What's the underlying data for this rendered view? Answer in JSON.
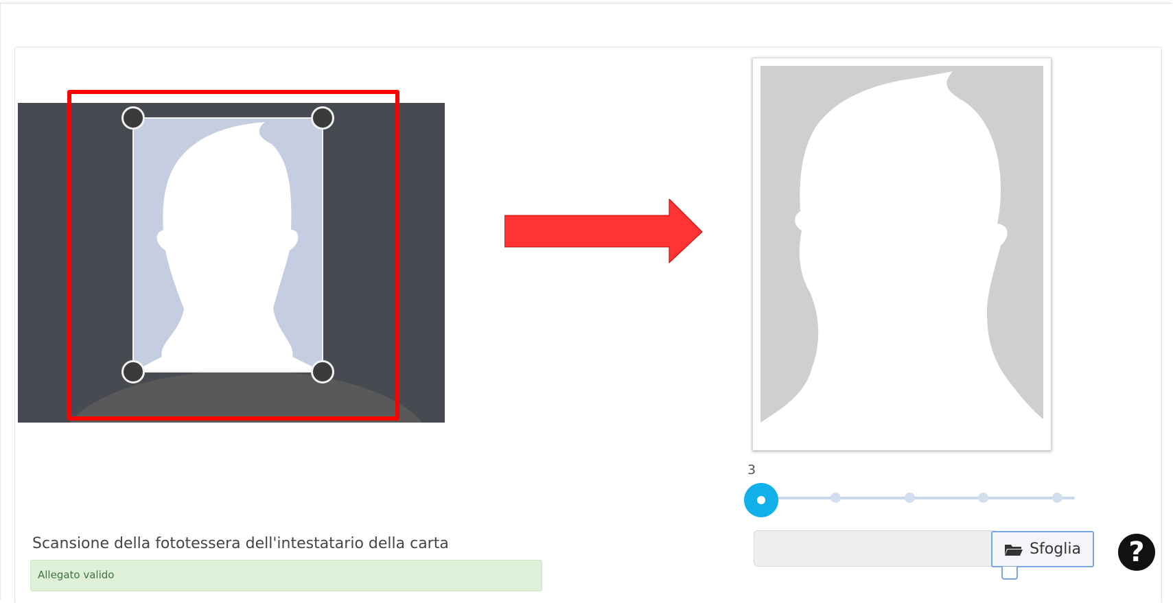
{
  "slider": {
    "value_label": "3",
    "steps": 5,
    "selected_index": 0,
    "accent_color": "#12b0ea"
  },
  "file_input": {
    "value": "",
    "browse_label": "Sfoglia",
    "browse_icon": "folder-open-icon"
  },
  "help": {
    "icon": "question-circle-icon",
    "glyph": "?"
  },
  "field": {
    "label": "Scansione della fototessera dell'intestatario della carta",
    "status": "Allegato valido",
    "status_color": "#dff0d8"
  },
  "annotations": {
    "highlight_color": "#ff0000",
    "arrow_color": "#ff3333"
  }
}
